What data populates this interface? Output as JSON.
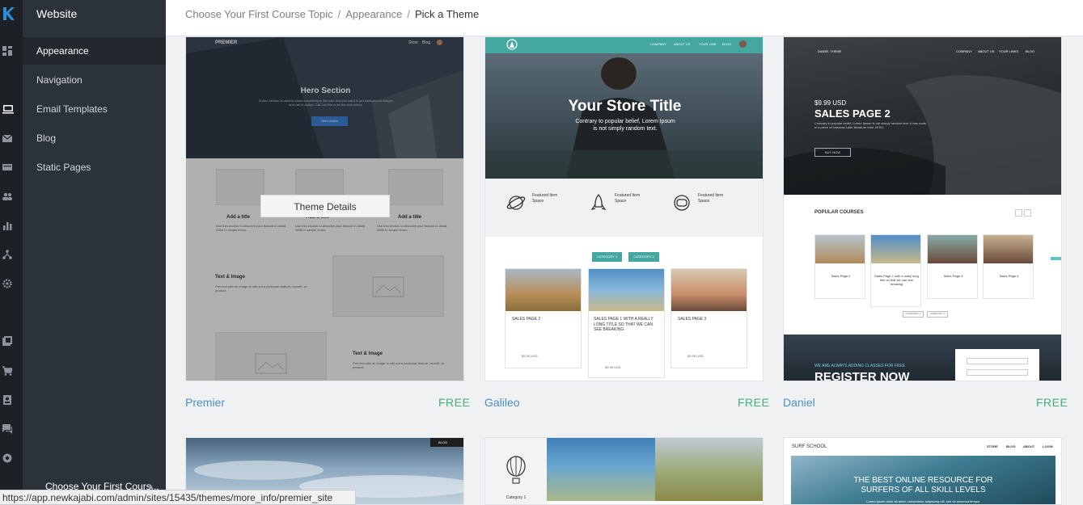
{
  "sidebar": {
    "title": "Website",
    "items": [
      {
        "label": "Appearance"
      },
      {
        "label": "Navigation"
      },
      {
        "label": "Email Templates"
      },
      {
        "label": "Blog"
      },
      {
        "label": "Static Pages"
      }
    ],
    "user_label": "Choose Your First Cours..."
  },
  "rail_icons": [
    "dashboard-icon",
    "website-icon",
    "email-icon",
    "offers-icon",
    "people-icon",
    "analytics-icon",
    "funnels-icon",
    "settings-icon",
    "products-icon",
    "store-icon",
    "contacts-icon",
    "support-chat-icon",
    "help-icon"
  ],
  "breadcrumb": {
    "items": [
      "Choose Your First Course Topic",
      "Appearance"
    ],
    "current": "Pick a Theme",
    "separator": "/"
  },
  "themes": [
    {
      "name": "Premier",
      "price": "FREE",
      "details_button": "Theme Details",
      "preview": {
        "logo": "PREMIER",
        "nav": [
          "Store",
          "Blog"
        ],
        "hero": "Hero Section",
        "hero_text": "A hero section is used to show something to the user that you want to get background images and call to action. Call Out this is for the text before.",
        "cta": "Get it Active",
        "feature_title": "Add a title",
        "feature_text": "Use this section to describe your feature in detail. Write in simple terms.",
        "text_image": "Text & Image",
        "text_image_body": "Pair text with an image to call out a particular feature, benefit, or product."
      }
    },
    {
      "name": "Galileo",
      "price": "FREE",
      "preview": {
        "nav": [
          "COMPANY",
          "ABOUT US",
          "YOUR LINK",
          "BLOG"
        ],
        "store_title": "Your Store Title",
        "store_sub": "Contrary to popular belief, Lorem Ipsum is not simply random text.",
        "featured": [
          "Featured Item Space",
          "Featured Item Space",
          "Featured Item Space"
        ],
        "categories": [
          "CATEGORY 1",
          "CATEGORY 2"
        ],
        "products": [
          {
            "title": "SALES PAGE 2",
            "price": "$9.99 USD"
          },
          {
            "title": "SALES PAGE 1 WITH A REALLY LONG TITLE SO THAT WE CAN SEE BREAKING",
            "price": "$9.99 USD"
          },
          {
            "title": "SALES PAGE 3",
            "price": "$9.99 USD"
          }
        ]
      }
    },
    {
      "name": "Daniel",
      "price": "FREE",
      "preview": {
        "logo": "DANIEL THEME",
        "nav": [
          "COMPANY",
          "ABOUT US",
          "YOUR LINKS",
          "BLOG"
        ],
        "price": "$9.99 USD",
        "headline": "SALES PAGE 2",
        "body": "Contrary to popular belief, Lorem Ipsum is not simply random text. It has roots in a piece of classical Latin literature from 45 BC.",
        "cta": "BUY NOW",
        "popular": "POPULAR COURSES",
        "courses": [
          "Sales Page 2",
          "Sales Page 1 with a really long title so that we can see breaking",
          "Sales Page 3",
          "Sales Page 4"
        ],
        "categories": [
          "CATEGORY 1",
          "CATEGORY 2"
        ],
        "banner_small": "WE ARE ALWAYS ADDING CLASSES FOR FREE",
        "banner": "REGISTER NOW"
      }
    },
    {
      "name": "",
      "preview": {
        "nav": [
          "BLOG"
        ]
      }
    },
    {
      "name": "",
      "preview": {
        "category": "Category 1"
      }
    },
    {
      "name": "",
      "preview": {
        "logo": "SURF SCHOOL",
        "nav": [
          "STORE",
          "BLOG",
          "ABOUT",
          "LOGIN"
        ],
        "headline": "THE BEST ONLINE RESOURCE FOR SURFERS OF ALL SKILL LEVELS",
        "body": "Lorem ipsum dolor sit amet, consectetur adipiscing elit, sed do eiusmod tempor"
      }
    }
  ],
  "status_url": "https://app.newkajabi.com/admin/sites/15435/themes/more_info/premier_site",
  "colors": {
    "accent": "#4a90c8",
    "free": "#43b07a",
    "teal": "#44a8a0",
    "sidebar": "#2c3239"
  }
}
